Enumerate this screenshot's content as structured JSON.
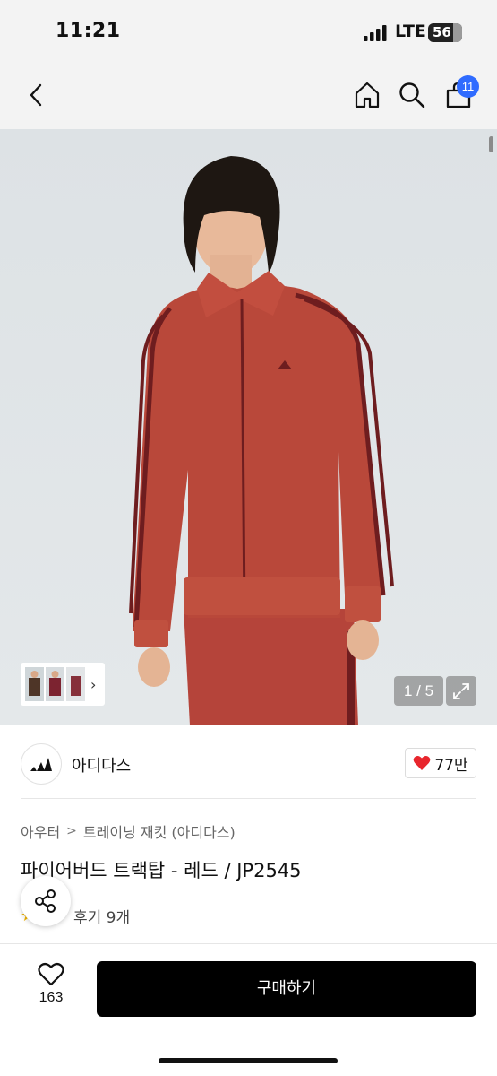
{
  "status_bar": {
    "time": "11:21",
    "network": "LTE",
    "battery": "56"
  },
  "nav": {
    "cart_count": "11",
    "icons": [
      "chevron-left-icon",
      "home-icon",
      "search-icon",
      "shopping-bag-icon"
    ]
  },
  "gallery": {
    "counter": "1 / 5",
    "thumb_next": "›"
  },
  "brand": {
    "name": "아디다스",
    "likes": "77만"
  },
  "breadcrumb": {
    "category": "아우터",
    "separator": ">",
    "subcategory": "트레이닝 재킷 (아디다스)"
  },
  "product": {
    "title": "파이어버드 트랙탑 - 레드 / JP2545",
    "review_link": "후기 9개"
  },
  "bottom_bar": {
    "wish_count": "163",
    "buy_label": "구매하기"
  },
  "colors": {
    "accent_blue": "#2f6bff",
    "heart_red": "#e8262d",
    "jacket_red": "#b9483a",
    "stripe_dark": "#6e1d1f"
  }
}
